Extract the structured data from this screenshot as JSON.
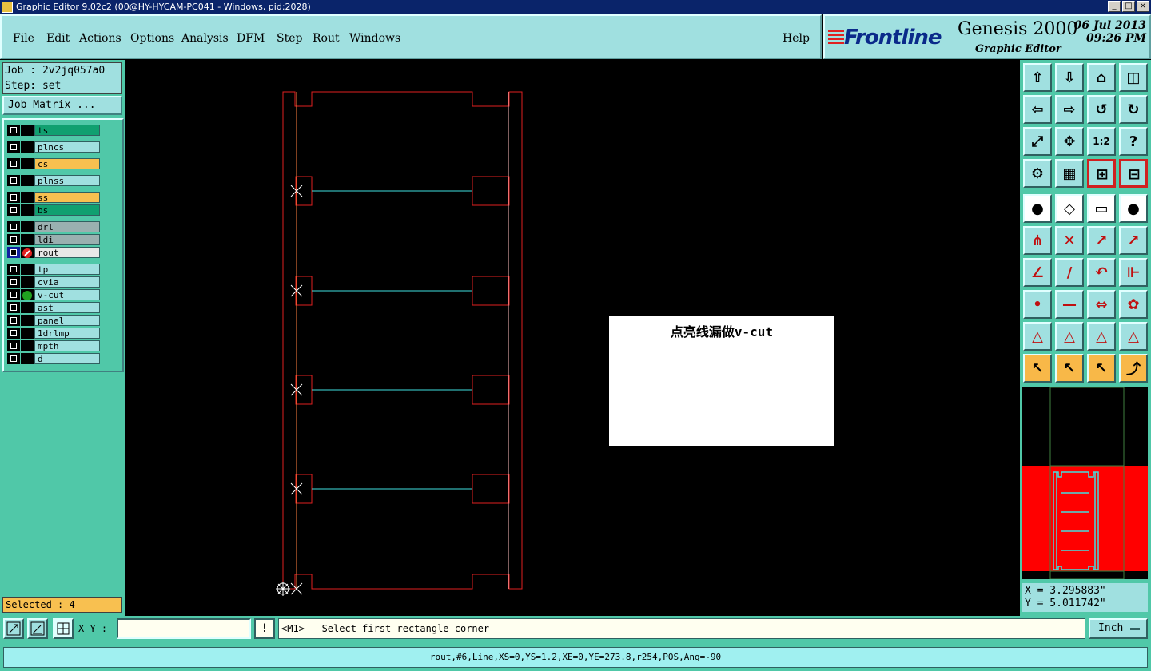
{
  "window": {
    "title": "Graphic Editor 9.02c2 (00@HY-HYCAM-PC041 - Windows, pid:2028)"
  },
  "menu": {
    "file": "File",
    "edit": "Edit",
    "actions": "Actions",
    "options": "Options",
    "analysis": "Analysis",
    "dfm": "DFM",
    "step": "Step",
    "rout": "Rout",
    "windows": "Windows",
    "help": "Help"
  },
  "brand": {
    "logo": "Frontline",
    "product": "Genesis 2000",
    "subtitle": "Graphic Editor",
    "date": "06 Jul 2013",
    "time": "09:26 PM"
  },
  "job": {
    "job_line": "Job : 2v2jq057a0",
    "step_line": "Step: set",
    "matrix_button": "Job Matrix ..."
  },
  "layers": [
    {
      "name": "ts",
      "color": "#10a070",
      "mark": ""
    },
    {
      "name": "plncs",
      "color": "#a0e0e0",
      "mark": ""
    },
    {
      "name": "cs",
      "color": "#f8c050",
      "mark": ""
    },
    {
      "name": "plnss",
      "color": "#a0e0e0",
      "mark": ""
    },
    {
      "name": "ss",
      "color": "#f8c050",
      "mark": ""
    },
    {
      "name": "bs",
      "color": "#10a070",
      "mark": ""
    },
    {
      "name": "drl",
      "color": "#9ab0b0",
      "mark": ""
    },
    {
      "name": "ldi",
      "color": "#9ab0b0",
      "mark": ""
    },
    {
      "name": "rout",
      "color": "#e8e8e8",
      "mark": "work"
    },
    {
      "name": "tp",
      "color": "#a0e0e0",
      "mark": ""
    },
    {
      "name": "cvia",
      "color": "#a0e0e0",
      "mark": ""
    },
    {
      "name": "v-cut",
      "color": "#a0e0e0",
      "mark": "display"
    },
    {
      "name": "ast",
      "color": "#a0e0e0",
      "mark": ""
    },
    {
      "name": "panel",
      "color": "#a0e0e0",
      "mark": ""
    },
    {
      "name": "1drlmp",
      "color": "#a0e0e0",
      "mark": ""
    },
    {
      "name": "mpth",
      "color": "#a0e0e0",
      "mark": ""
    },
    {
      "name": "d",
      "color": "#a0e0e0",
      "mark": ""
    }
  ],
  "selected": "Selected : 4",
  "popup": {
    "text": "点亮线漏做v-cut"
  },
  "coords": {
    "x": "X = 3.295883\"",
    "y": "Y = 5.011742\""
  },
  "bottom": {
    "xy_label": "X Y :",
    "xy_value": "",
    "exclaim": "!",
    "prompt": "<M1> - Select first rectangle corner",
    "units": "Inch"
  },
  "status": "rout,#6,Line,XS=0,YS=1.2,XE=0,YE=273.8,r254,POS,Ang=-90",
  "colors": {
    "outline": "#e02020",
    "vcut": "#40e0e0",
    "cross": "#ffffff"
  },
  "toolbar_icons": [
    "panel-up-icon",
    "panel-down-icon",
    "home-icon",
    "split-view-icon",
    "panel-left-icon",
    "panel-right-icon",
    "undo-zoom-icon",
    "redo-zoom-icon",
    "fit-all-icon",
    "fit-center-icon",
    "scale-1-2-icon",
    "help-question-icon",
    "settings-tools-icon",
    "grid-icon",
    "snap-mode-a-icon",
    "snap-mode-b-icon",
    "add-pad-icon",
    "add-shape-icon",
    "ruler-icon",
    "select-pad-icon",
    "connect-nodes-icon",
    "cross-pad-icon",
    "move-pad-icon",
    "move-pad-alt-icon",
    "angle-line-icon",
    "draw-line-icon",
    "arc-icon",
    "mirror-text-icon",
    "pad-to-line-icon",
    "line-split-icon",
    "measure-icon",
    "shapes-icon",
    "triangle-a-icon",
    "triangle-b-icon",
    "triangle-c-icon",
    "triangle-d-icon",
    "pointer-icon",
    "pointer-select-icon",
    "pointer-circle-icon",
    "route-path-icon"
  ]
}
